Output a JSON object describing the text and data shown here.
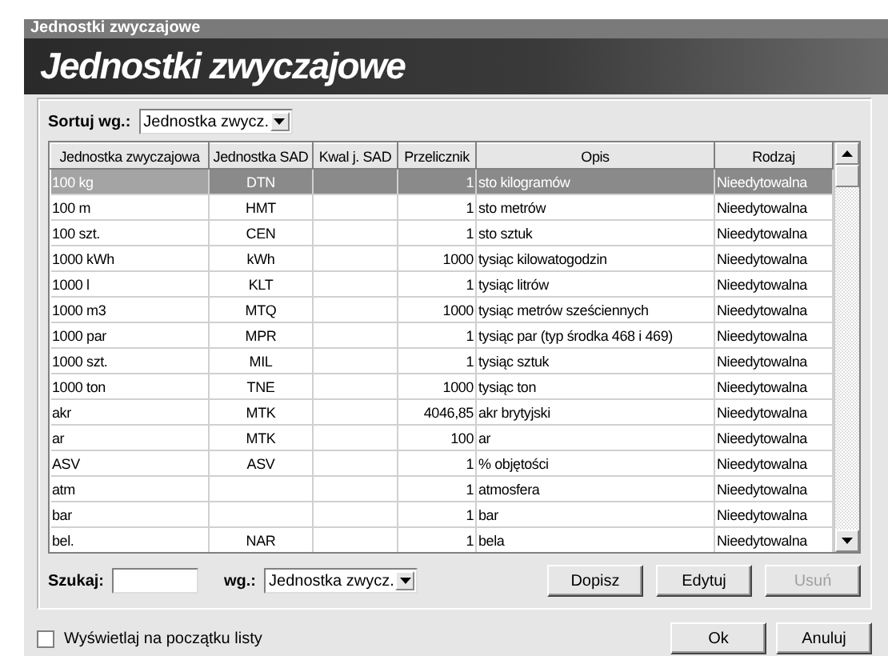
{
  "window": {
    "title": "Jednostki zwyczajowe"
  },
  "banner": {
    "title": "Jednostki zwyczajowe"
  },
  "sort": {
    "label": "Sortuj wg.:",
    "value": "Jednostka zwycz."
  },
  "table": {
    "columns": [
      "Jednostka zwyczajowa",
      "Jednostka SAD",
      "Kwal j. SAD",
      "Przelicznik",
      "Opis",
      "Rodzaj"
    ],
    "rows": [
      {
        "cells": [
          "100 kg",
          "DTN",
          "",
          "1",
          "sto kilogramów",
          "Nieedytowalna"
        ],
        "selected": true
      },
      {
        "cells": [
          "100 m",
          "HMT",
          "",
          "1",
          "sto metrów",
          "Nieedytowalna"
        ],
        "selected": false
      },
      {
        "cells": [
          "100 szt.",
          "CEN",
          "",
          "1",
          "sto sztuk",
          "Nieedytowalna"
        ],
        "selected": false
      },
      {
        "cells": [
          "1000 kWh",
          "kWh",
          "",
          "1000",
          "tysiąc kilowatogodzin",
          "Nieedytowalna"
        ],
        "selected": false
      },
      {
        "cells": [
          "1000 l",
          "KLT",
          "",
          "1",
          "tysiąc litrów",
          "Nieedytowalna"
        ],
        "selected": false
      },
      {
        "cells": [
          "1000 m3",
          "MTQ",
          "",
          "1000",
          "tysiąc metrów sześciennych",
          "Nieedytowalna"
        ],
        "selected": false
      },
      {
        "cells": [
          "1000 par",
          "MPR",
          "",
          "1",
          "tysiąc par (typ środka 468 i 469)",
          "Nieedytowalna"
        ],
        "selected": false
      },
      {
        "cells": [
          "1000 szt.",
          "MIL",
          "",
          "1",
          "tysiąc sztuk",
          "Nieedytowalna"
        ],
        "selected": false
      },
      {
        "cells": [
          "1000 ton",
          "TNE",
          "",
          "1000",
          "tysiąc ton",
          "Nieedytowalna"
        ],
        "selected": false
      },
      {
        "cells": [
          "akr",
          "MTK",
          "",
          "4046,85",
          "akr brytyjski",
          "Nieedytowalna"
        ],
        "selected": false
      },
      {
        "cells": [
          "ar",
          "MTK",
          "",
          "100",
          "ar",
          "Nieedytowalna"
        ],
        "selected": false
      },
      {
        "cells": [
          "ASV",
          "ASV",
          "",
          "1",
          "% objętości",
          "Nieedytowalna"
        ],
        "selected": false
      },
      {
        "cells": [
          "atm",
          "",
          "",
          "1",
          "atmosfera",
          "Nieedytowalna"
        ],
        "selected": false
      },
      {
        "cells": [
          "bar",
          "",
          "",
          "1",
          "bar",
          "Nieedytowalna"
        ],
        "selected": false
      },
      {
        "cells": [
          "bel.",
          "NAR",
          "",
          "1",
          "bela",
          "Nieedytowalna"
        ],
        "selected": false
      }
    ]
  },
  "search": {
    "label": "Szukaj:",
    "by_label": "wg.:",
    "by_value": "Jednostka zwycz."
  },
  "actions": [
    {
      "label": "Dopisz",
      "disabled": false
    },
    {
      "label": "Edytuj",
      "disabled": false
    },
    {
      "label": "Usuń",
      "disabled": true
    }
  ],
  "show_first": {
    "label": "Wyświetlaj na początku listy",
    "checked": false
  },
  "buttons": [
    {
      "label": "Ok"
    },
    {
      "label": "Anuluj"
    }
  ]
}
